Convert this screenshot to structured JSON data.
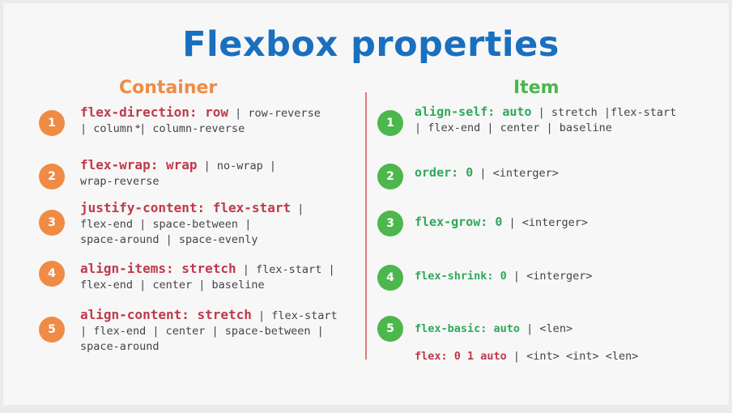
{
  "title": "Flexbox properties",
  "container": {
    "heading": "Container",
    "items": [
      {
        "num": "1",
        "key": "flex-direction: row",
        "rest1": " | row-reverse",
        "line2": "| column | column-reverse"
      },
      {
        "num": "2",
        "key": "flex-wrap: wrap",
        "rest1": " | no-wrap |",
        "line2": "wrap-reverse"
      },
      {
        "num": "3",
        "key": "justify-content: flex-start",
        "rest1": " |",
        "line2": "flex-end | space-between |",
        "line3": "space-around | space-evenly"
      },
      {
        "num": "4",
        "key": "align-items: stretch",
        "rest1": " | flex-start |",
        "line2": "flex-end | center | baseline"
      },
      {
        "num": "5",
        "key": "align-content: stretch",
        "rest1": " | flex-start",
        "line2": "| flex-end | center | space-between |",
        "line3": "space-around"
      }
    ]
  },
  "item": {
    "heading": "Item",
    "items": [
      {
        "num": "1",
        "key": "align-self: auto",
        "rest1": " | stretch |flex-start",
        "line2": "| flex-end | center | baseline"
      },
      {
        "num": "2",
        "key": "order: 0",
        "rest1": " | <interger>"
      },
      {
        "num": "3",
        "key": "flex-grow: 0",
        "rest1": " | <interger>"
      },
      {
        "num": "4",
        "key": "flex-shrink: 0",
        "rest1": " | <interger>"
      },
      {
        "num": "5",
        "key": "flex-basic: auto",
        "rest1": " | <len>"
      }
    ],
    "extra": {
      "key": "flex: 0 1 auto",
      "rest": " | <int> <int> <len>"
    }
  },
  "colors": {
    "title": "#1a6fbf",
    "container": "#f08b45",
    "item": "#4cb74c",
    "keyword_red": "#c0394b",
    "keyword_green": "#2fa85a"
  }
}
